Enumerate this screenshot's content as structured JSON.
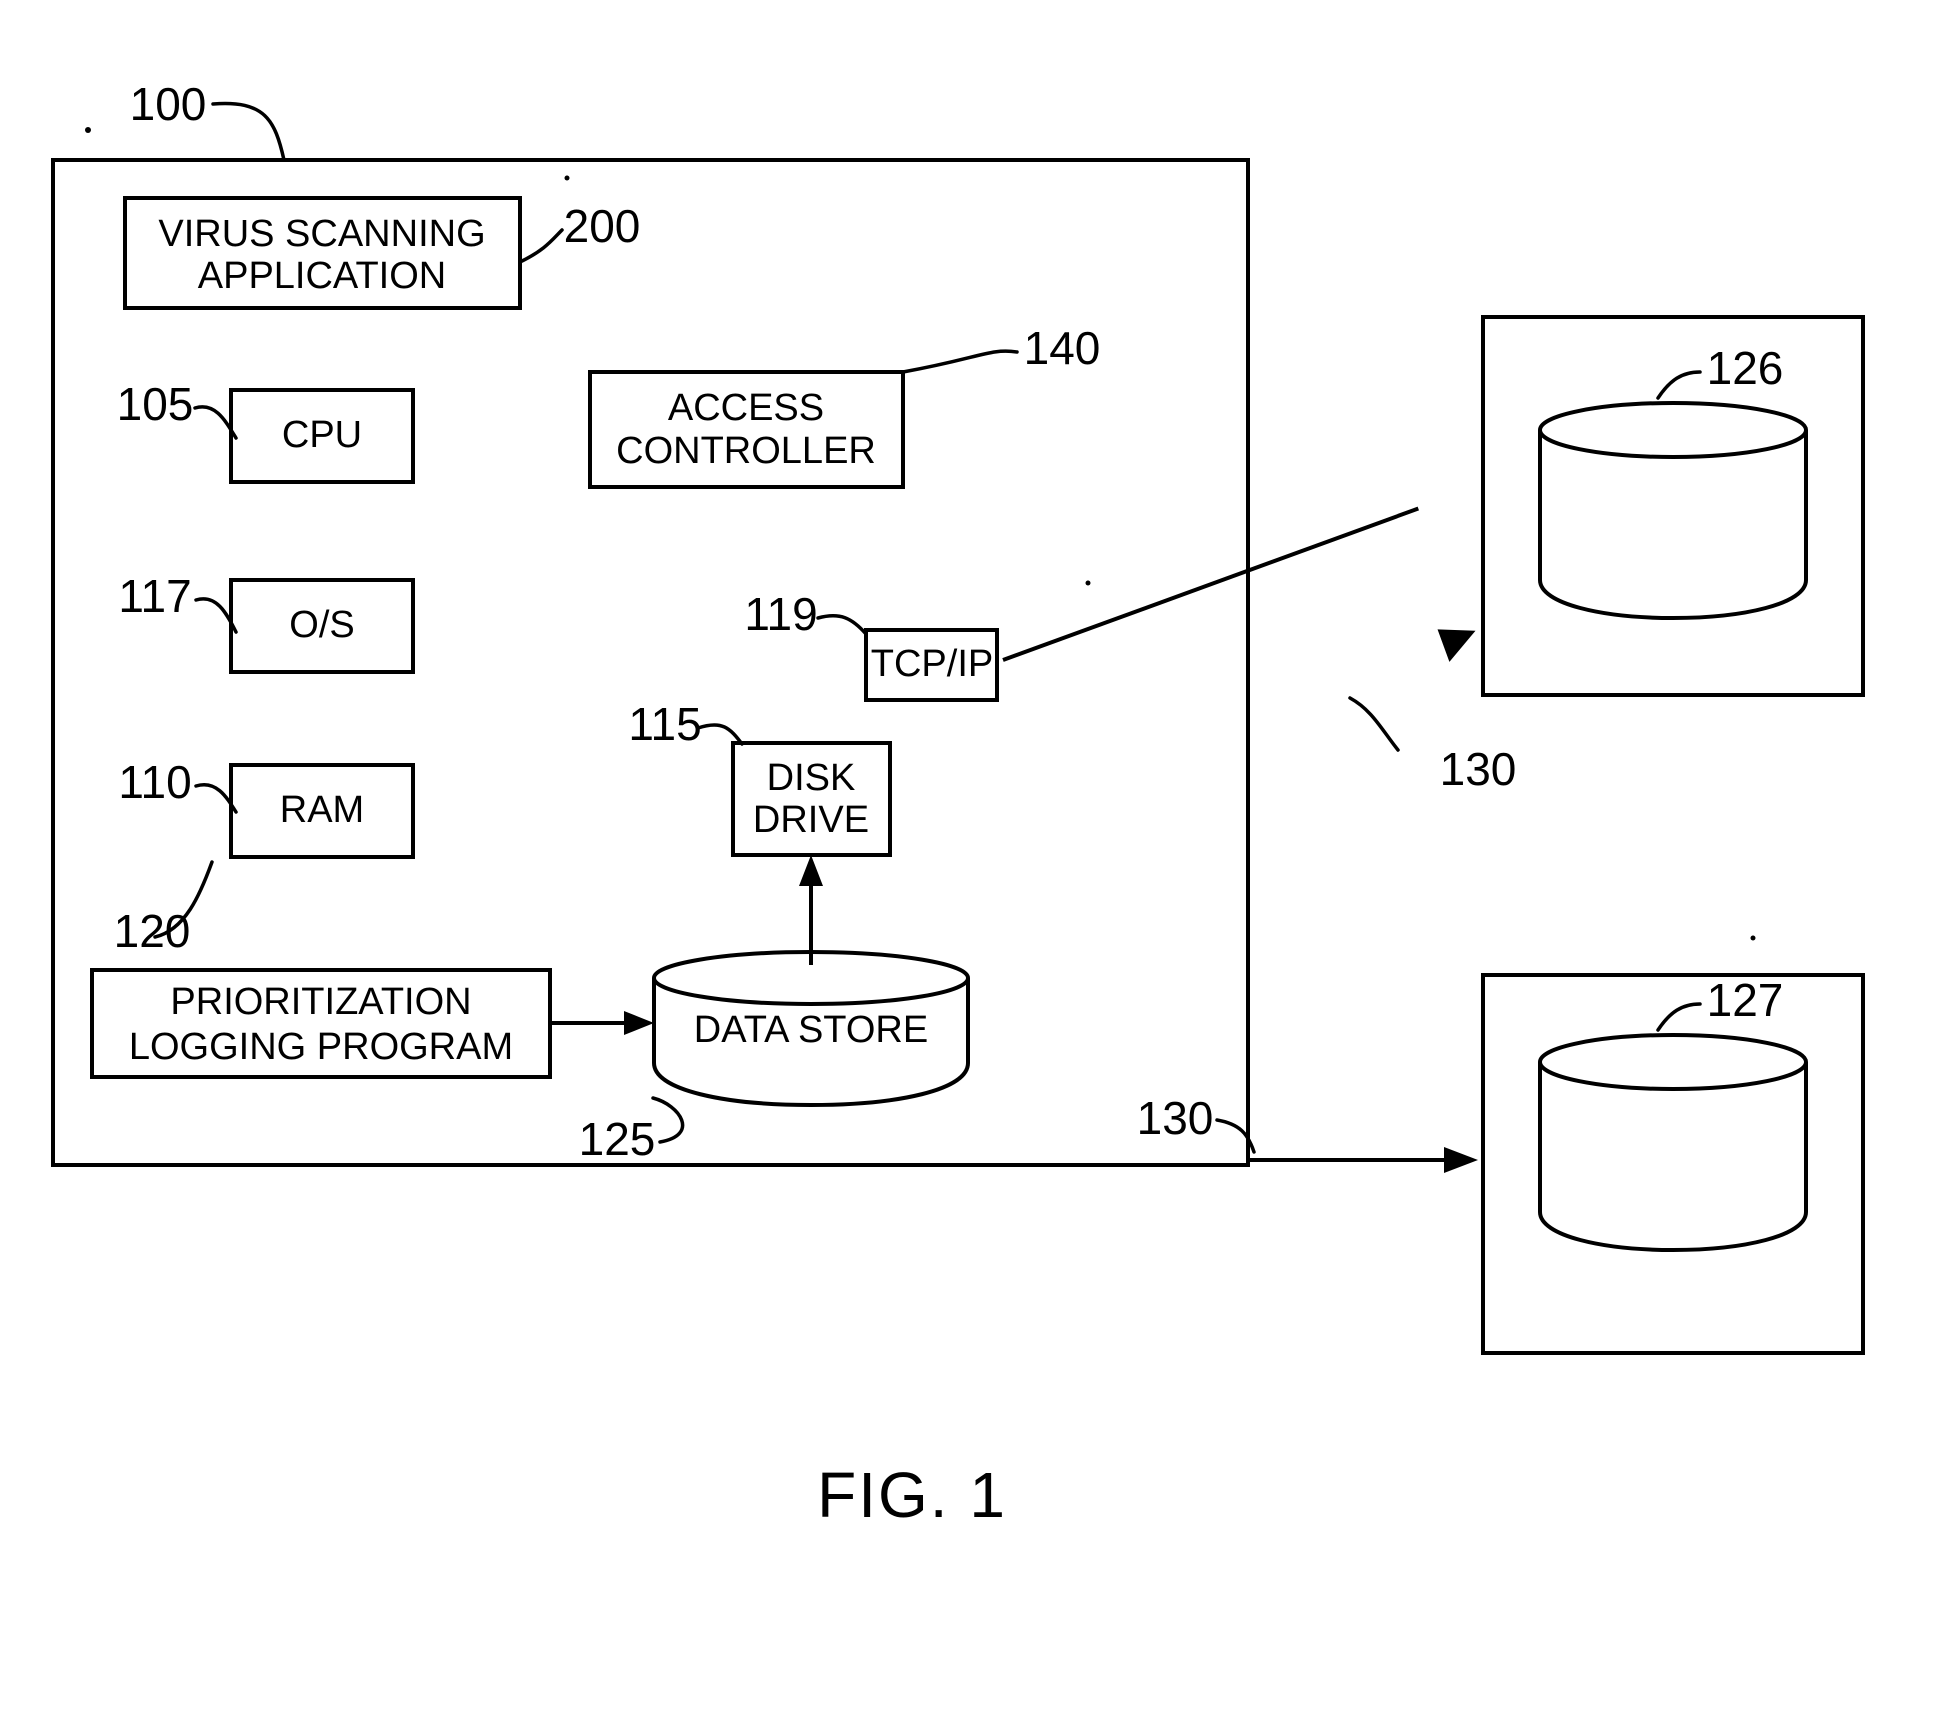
{
  "figure": {
    "caption": "FIG. 1"
  },
  "system": {
    "ref": "100",
    "name": "computer-system-container"
  },
  "blocks": [
    {
      "id": "virus-scanning-application",
      "label_line1": "VIRUS SCANNING",
      "label_line2": "APPLICATION",
      "ref": "200"
    },
    {
      "id": "cpu",
      "label_line1": "CPU",
      "label_line2": "",
      "ref": "105"
    },
    {
      "id": "os",
      "label_line1": "O/S",
      "label_line2": "",
      "ref": "117"
    },
    {
      "id": "ram",
      "label_line1": "RAM",
      "label_line2": "",
      "ref": "110"
    },
    {
      "id": "prioritization-logging-program",
      "label_line1": "PRIORITIZATION",
      "label_line2": "LOGGING PROGRAM",
      "ref": "120"
    },
    {
      "id": "access-controller",
      "label_line1": "ACCESS",
      "label_line2": "CONTROLLER",
      "ref": "140"
    },
    {
      "id": "tcp-ip",
      "label_line1": "TCP/IP",
      "label_line2": "",
      "ref": "119"
    },
    {
      "id": "disk-drive",
      "label_line1": "DISK",
      "label_line2": "DRIVE",
      "ref": "115"
    },
    {
      "id": "data-store",
      "label_line1": "DATA STORE",
      "label_line2": "",
      "ref": "125"
    }
  ],
  "external_stores": [
    {
      "id": "remote-store-top",
      "ref": "126"
    },
    {
      "id": "remote-store-bottom",
      "ref": "127"
    }
  ],
  "network_links": [
    {
      "id": "network-link-top",
      "ref": "130"
    },
    {
      "id": "network-link-bottom",
      "ref": "130"
    }
  ],
  "labels": {
    "sys_100": "100",
    "virus_200": "200",
    "cpu_105": "105",
    "os_117": "117",
    "ram_110": "110",
    "prog_120": "120",
    "access_140": "140",
    "tcpip_119": "119",
    "disk_115": "115",
    "datastore_125": "125",
    "store_126": "126",
    "store_127": "127",
    "net_130_top": "130",
    "net_130_bottom": "130"
  },
  "text": {
    "virus_l1": "VIRUS SCANNING",
    "virus_l2": "APPLICATION",
    "cpu": "CPU",
    "os": "O/S",
    "ram": "RAM",
    "prog_l1": "PRIORITIZATION",
    "prog_l2": "LOGGING PROGRAM",
    "access_l1": "ACCESS",
    "access_l2": "CONTROLLER",
    "tcpip": "TCP/IP",
    "disk_l1": "DISK",
    "disk_l2": "DRIVE",
    "datastore": "DATA STORE",
    "caption": "FIG. 1"
  },
  "colors": {
    "line": "#000000",
    "background": "#ffffff"
  }
}
